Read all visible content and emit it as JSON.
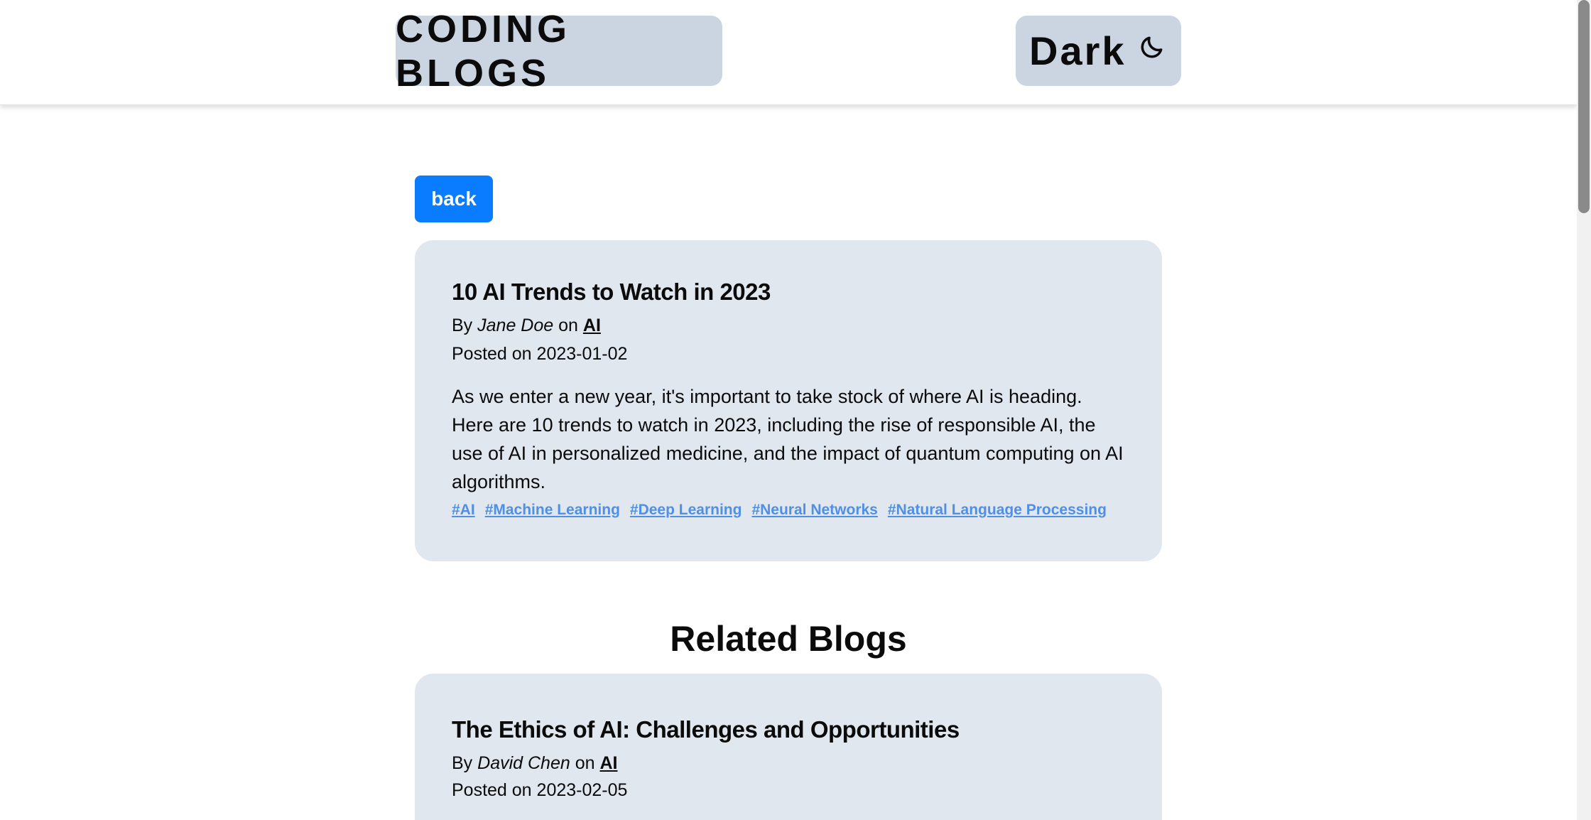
{
  "header": {
    "brand": "CODING BLOGS",
    "theme_toggle_label": "Dark",
    "theme_icon": "moon-icon"
  },
  "back_label": "back",
  "post": {
    "title": "10 AI Trends to Watch in 2023",
    "by_label": "By",
    "author": "Jane Doe",
    "on_label": "on",
    "category": "AI",
    "posted_label": "Posted on",
    "date": "2023-01-02",
    "description": "As we enter a new year, it's important to take stock of where AI is heading. Here are 10 trends to watch in 2023, including the rise of responsible AI, the use of AI in personalized medicine, and the impact of quantum computing on AI algorithms.",
    "tags": [
      "#AI",
      "#Machine Learning",
      "#Deep Learning",
      "#Neural Networks",
      "#Natural Language Processing"
    ]
  },
  "related": {
    "heading": "Related Blogs",
    "items": [
      {
        "title": "The Ethics of AI: Challenges and Opportunities",
        "by_label": "By",
        "author": "David Chen",
        "on_label": "on",
        "category": "AI",
        "posted_label": "Posted on",
        "date": "2023-02-05"
      }
    ]
  },
  "colors": {
    "accent": "#0a7cff",
    "card_bg": "#e1e7ef",
    "header_pill": "#cbd5e1",
    "tag_link": "#4f8fe6"
  }
}
